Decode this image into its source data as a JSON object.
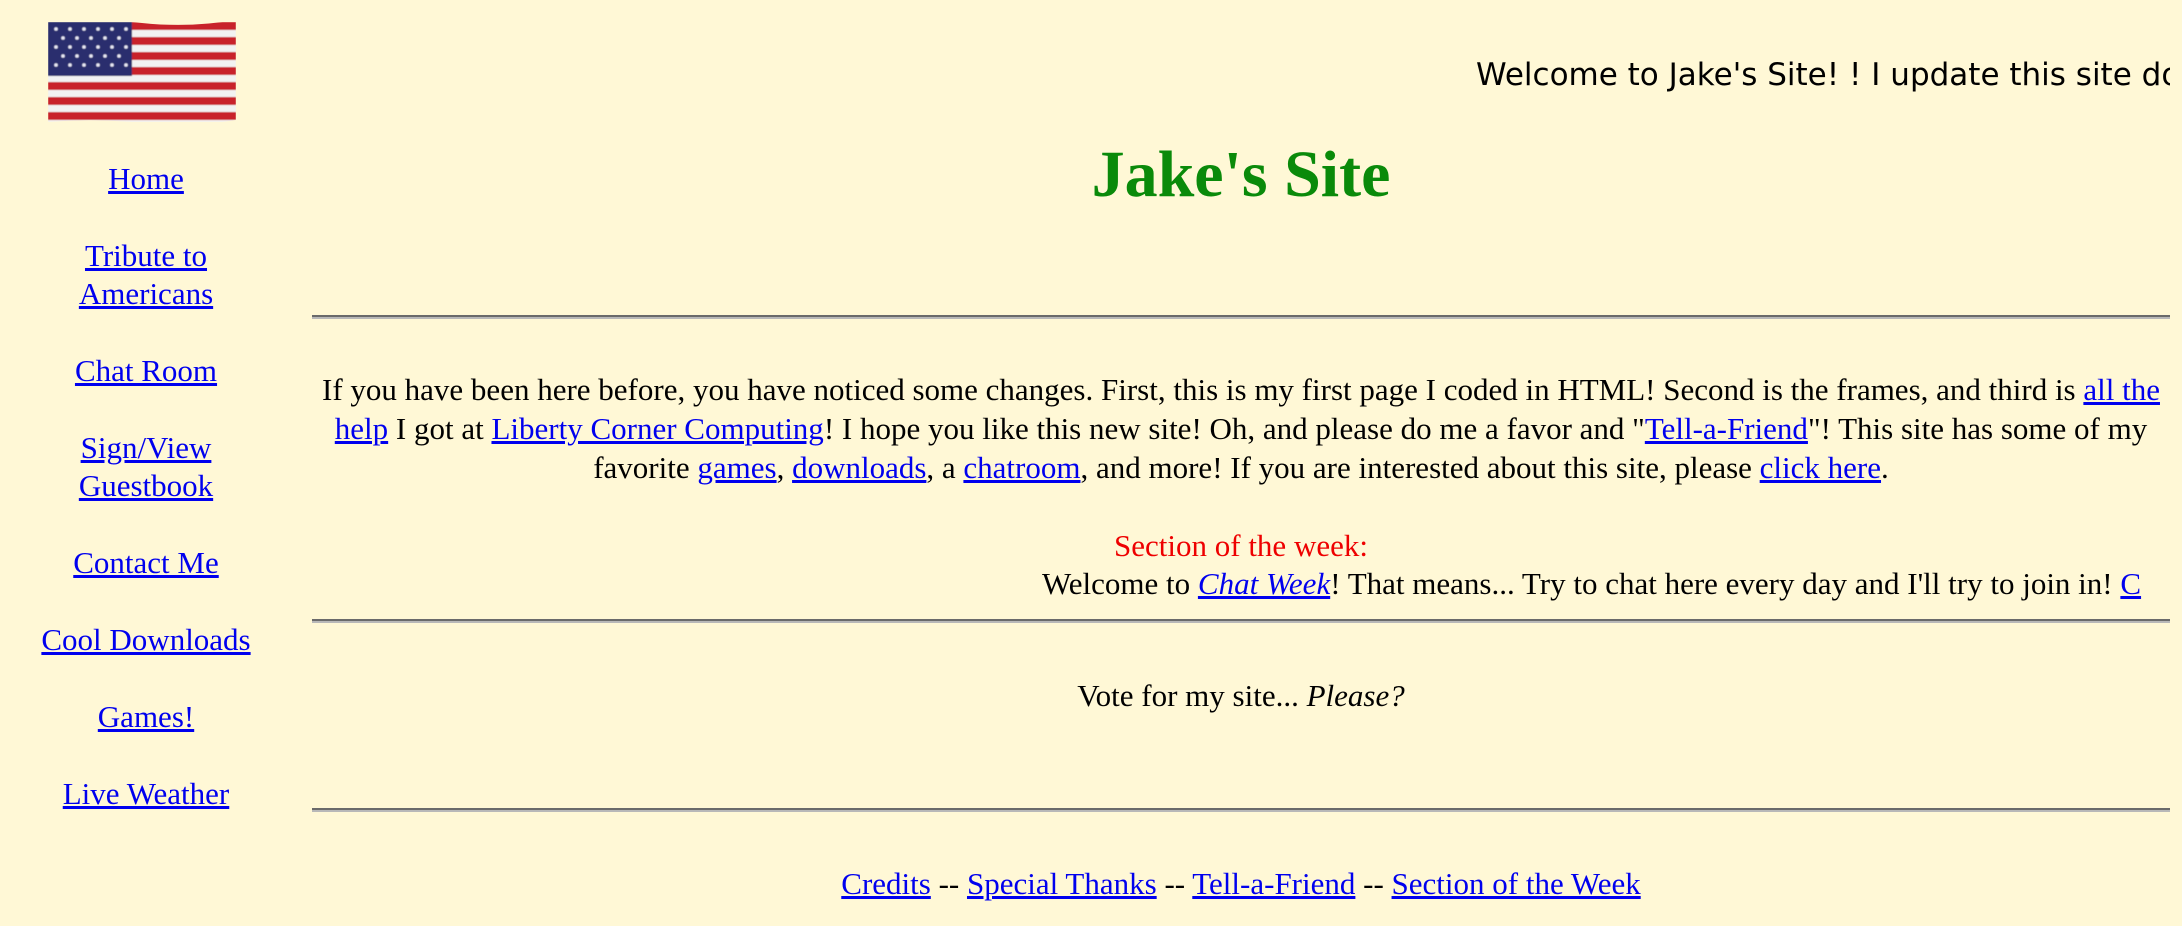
{
  "sidebar": {
    "flag_icon": "american-flag-icon",
    "items": [
      {
        "label": "Home"
      },
      {
        "label": "Tribute to Americans"
      },
      {
        "label": "Chat Room"
      },
      {
        "label": "Sign/View Guestbook"
      },
      {
        "label": "Contact Me"
      },
      {
        "label": "Cool Downloads"
      },
      {
        "label": "Games!"
      },
      {
        "label": "Live Weather"
      }
    ]
  },
  "main": {
    "marquee_text": "Welcome to Jake's Site! ! I update this site do",
    "title": "Jake's Site",
    "title_color": "#0a8a0a",
    "intro": {
      "part1": "If you have been here before, you have noticed some changes. First, this is my first page I coded in HTML! Second is the frames, and third is ",
      "link_help": "all the help",
      "part2": " I got at ",
      "link_liberty": "Liberty Corner Computing",
      "part3": "! I hope you like this new site! Oh, and please do me a favor and \"",
      "link_tell": "Tell-a-Friend",
      "part4": "\"! This site has some of my favorite ",
      "link_games": "games",
      "sep1": ", ",
      "link_downloads": "downloads",
      "part5": ", a ",
      "link_chatroom": "chatroom",
      "part6": ", and more! If you are interested about this site, please ",
      "link_click": "click here",
      "part7": "."
    },
    "section": {
      "label": "Section of the week:",
      "label_color": "#ee0000",
      "prefix": "Welcome to ",
      "link": "Chat Week",
      "text": "! That means... Try to chat here every day and I'll try to join in! ",
      "trailing_link": "C"
    },
    "vote": {
      "text": "Vote for my site... ",
      "emphasis": "Please?"
    },
    "footer": {
      "credits": "Credits",
      "special_thanks": "Special Thanks",
      "tell_a_friend": "Tell-a-Friend",
      "section_of_week": "Section of the Week",
      "separator": " -- "
    }
  }
}
